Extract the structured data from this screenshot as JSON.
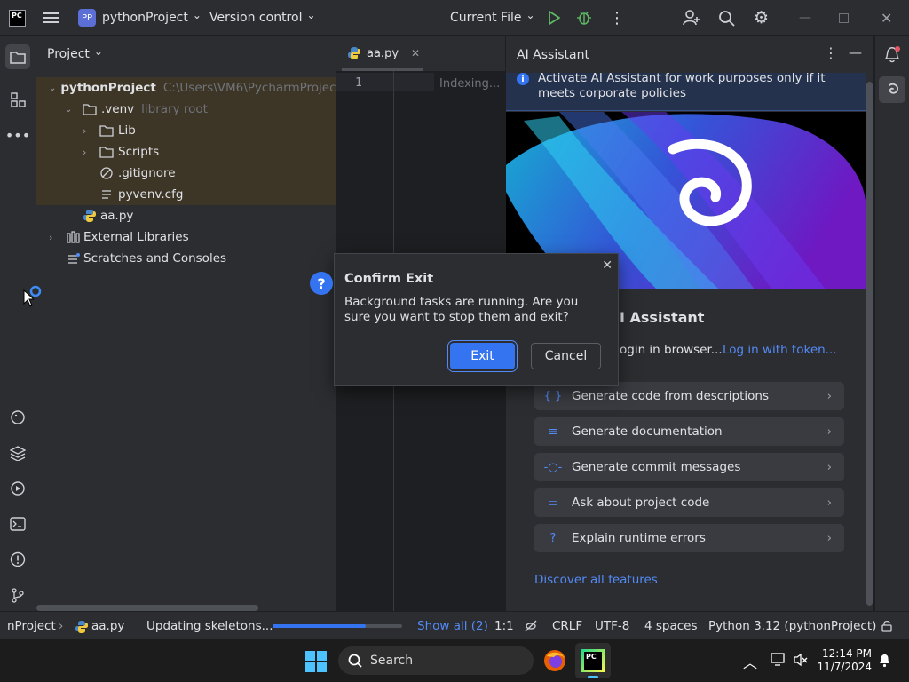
{
  "titlebar": {
    "app_badge": "PC",
    "project_badge": "PP",
    "project_name": "pythonProject",
    "vcs_label": "Version control",
    "run_config": "Current File"
  },
  "project_panel": {
    "title": "Project",
    "tree": [
      {
        "label": "pythonProject",
        "hint": "C:\\Users\\VM6\\PycharmProject"
      },
      {
        "label": ".venv",
        "hint": "library root"
      },
      {
        "label": "Lib",
        "hint": ""
      },
      {
        "label": "Scripts",
        "hint": ""
      },
      {
        "label": ".gitignore",
        "hint": ""
      },
      {
        "label": "pyvenv.cfg",
        "hint": ""
      },
      {
        "label": "aa.py",
        "hint": ""
      },
      {
        "label": "External Libraries",
        "hint": ""
      },
      {
        "label": "Scratches and Consoles",
        "hint": ""
      }
    ]
  },
  "editor": {
    "tab_label": "aa.py",
    "line_number": "1",
    "status": "Indexing..."
  },
  "ai_assistant": {
    "title": "AI Assistant",
    "banner": "Activate AI Assistant for work purposes only if it meets corporate policies",
    "heading_partial": "I Assistant",
    "login_partial": "ogin in browser...",
    "login_token_link": "Log in with token...",
    "features": [
      {
        "label": "Generate code from descriptions",
        "icon": "braces-icon"
      },
      {
        "label": "Generate documentation",
        "icon": "doc-lines-icon"
      },
      {
        "label": "Generate commit messages",
        "icon": "commit-icon"
      },
      {
        "label": "Ask about project code",
        "icon": "chat-icon"
      },
      {
        "label": "Explain runtime errors",
        "icon": "question-circle-icon"
      }
    ],
    "discover_link": "Discover all features"
  },
  "dialog": {
    "title": "Confirm Exit",
    "message": "Background tasks are running. Are you sure you want to stop them and exit?",
    "exit_label": "Exit",
    "cancel_label": "Cancel"
  },
  "statusbar": {
    "breadcrumb_project": "nProject",
    "breadcrumb_file": "aa.py",
    "task": "Updating skeletons...",
    "progress_fraction": 0.72,
    "show_all": "Show all (2)",
    "position": "1:1",
    "line_sep": "CRLF",
    "encoding": "UTF-8",
    "indent": "4 spaces",
    "interpreter": "Python 3.12 (pythonProject)"
  },
  "taskbar": {
    "search_placeholder": "Search",
    "time": "12:14 PM",
    "date": "11/7/2024"
  },
  "colors": {
    "accent": "#3574f0",
    "link": "#548af7",
    "library_bg": "#3d3526"
  }
}
